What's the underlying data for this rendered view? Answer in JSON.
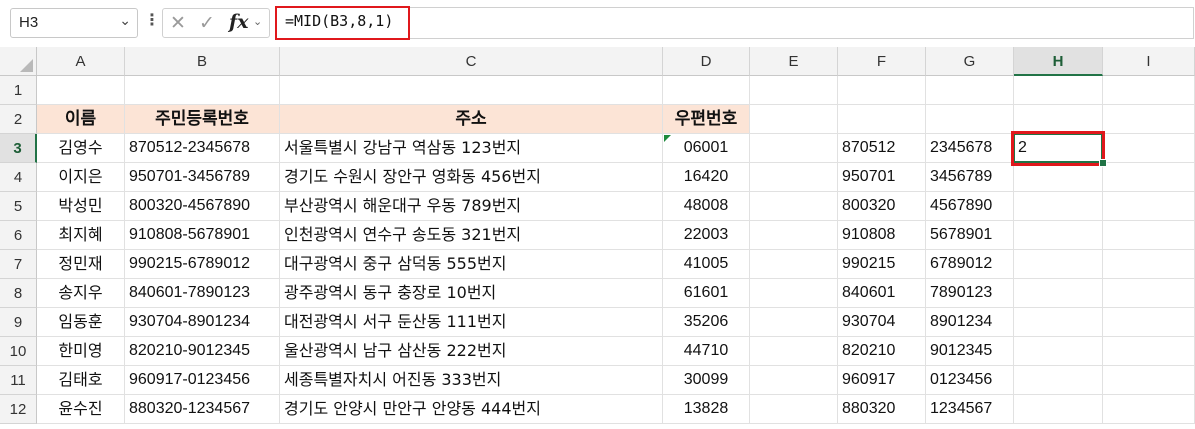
{
  "formula_bar": {
    "name_box": "H3",
    "formula": "=MID(B3,8,1)"
  },
  "columns": [
    "A",
    "B",
    "C",
    "D",
    "E",
    "F",
    "G",
    "H",
    "I"
  ],
  "rows": [
    "1",
    "2",
    "3",
    "4",
    "5",
    "6",
    "7",
    "8",
    "9",
    "10",
    "11",
    "12"
  ],
  "selected_column": "H",
  "selected_row": "3",
  "headers": {
    "name": "이름",
    "rrn": "주민등록번호",
    "address": "주소",
    "zip": "우편번호"
  },
  "data_rows": [
    {
      "name": "김영수",
      "rrn": "870512-2345678",
      "address": "서울특별시 강남구 역삼동 123번지",
      "zip": "06001",
      "f": "870512",
      "g": "2345678",
      "h": "2"
    },
    {
      "name": "이지은",
      "rrn": "950701-3456789",
      "address": "경기도 수원시 장안구 영화동 456번지",
      "zip": "16420",
      "f": "950701",
      "g": "3456789",
      "h": ""
    },
    {
      "name": "박성민",
      "rrn": "800320-4567890",
      "address": "부산광역시 해운대구 우동 789번지",
      "zip": "48008",
      "f": "800320",
      "g": "4567890",
      "h": ""
    },
    {
      "name": "최지혜",
      "rrn": "910808-5678901",
      "address": "인천광역시 연수구 송도동 321번지",
      "zip": "22003",
      "f": "910808",
      "g": "5678901",
      "h": ""
    },
    {
      "name": "정민재",
      "rrn": "990215-6789012",
      "address": "대구광역시 중구 삼덕동 555번지",
      "zip": "41005",
      "f": "990215",
      "g": "6789012",
      "h": ""
    },
    {
      "name": "송지우",
      "rrn": "840601-7890123",
      "address": "광주광역시 동구 충장로 10번지",
      "zip": "61601",
      "f": "840601",
      "g": "7890123",
      "h": ""
    },
    {
      "name": "임동훈",
      "rrn": "930704-8901234",
      "address": "대전광역시 서구 둔산동 111번지",
      "zip": "35206",
      "f": "930704",
      "g": "8901234",
      "h": ""
    },
    {
      "name": "한미영",
      "rrn": "820210-9012345",
      "address": "울산광역시 남구 삼산동 222번지",
      "zip": "44710",
      "f": "820210",
      "g": "9012345",
      "h": ""
    },
    {
      "name": "김태호",
      "rrn": "960917-0123456",
      "address": "세종특별자치시 어진동 333번지",
      "zip": "30099",
      "f": "960917",
      "g": "0123456",
      "h": ""
    },
    {
      "name": "윤수진",
      "rrn": "880320-1234567",
      "address": "경기도 안양시 만안구 안양동 444번지",
      "zip": "13828",
      "f": "880320",
      "g": "1234567",
      "h": ""
    }
  ],
  "icons": {
    "dropdown": "chevron-down-icon",
    "cancel": "close-icon",
    "enter": "check-icon",
    "function": "fx-icon"
  },
  "colors": {
    "header_fill": "#fce4d6",
    "selection": "#217346",
    "highlight": "#e0181c"
  }
}
